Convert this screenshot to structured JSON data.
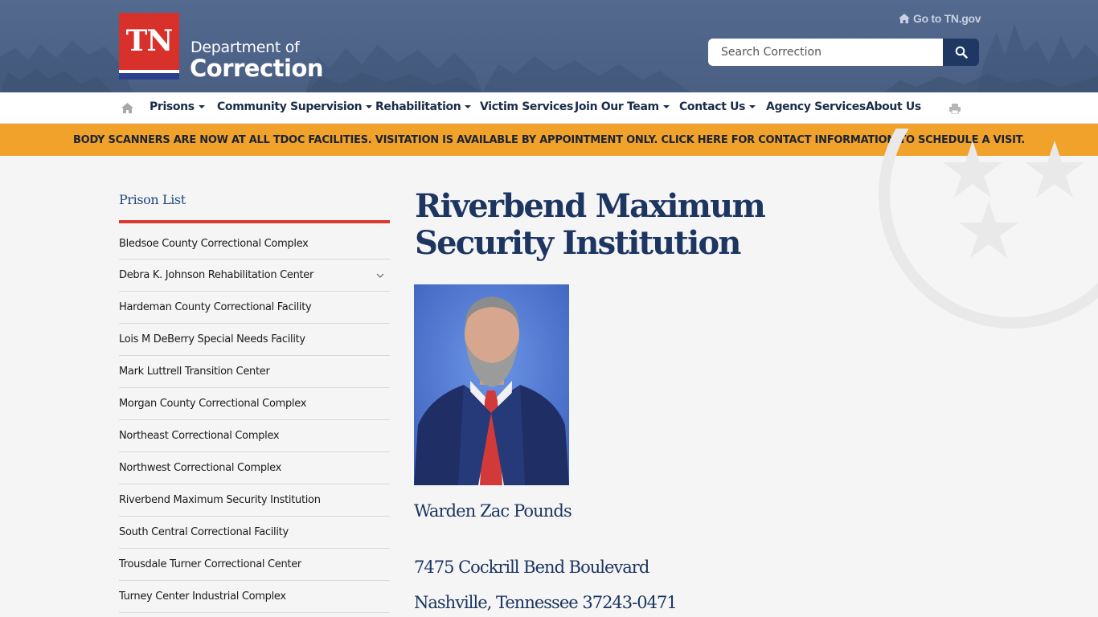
{
  "header": {
    "logo_text": "TN",
    "dept_line1": "Department of",
    "dept_line2": "Correction",
    "go_to_tn": "Go to TN.gov",
    "search_placeholder": "Search Correction"
  },
  "nav": {
    "items": [
      {
        "label": "Prisons",
        "dropdown": true
      },
      {
        "label": "Community Supervision",
        "dropdown": true
      },
      {
        "label": "Rehabilitation",
        "dropdown": true
      },
      {
        "label": "Victim Services",
        "dropdown": false
      },
      {
        "label": "Join Our Team",
        "dropdown": true
      },
      {
        "label": "Contact Us",
        "dropdown": true
      },
      {
        "label": "Agency Services",
        "dropdown": false
      },
      {
        "label": "About Us",
        "dropdown": false
      }
    ]
  },
  "alert": {
    "text": "BODY SCANNERS ARE NOW AT ALL TDOC FACILITIES. VISITATION IS AVAILABLE BY APPOINTMENT ONLY. CLICK HERE FOR CONTACT INFORMATION TO SCHEDULE A VISIT."
  },
  "sidebar": {
    "title": "Prison List",
    "items": [
      {
        "label": "Bledsoe County Correctional Complex"
      },
      {
        "label": "Debra K. Johnson Rehabilitation Center"
      },
      {
        "label": "Hardeman County Correctional Facility"
      },
      {
        "label": "Lois M DeBerry Special Needs Facility"
      },
      {
        "label": "Mark Luttrell Transition Center"
      },
      {
        "label": "Morgan County Correctional Complex"
      },
      {
        "label": "Northeast Correctional Complex"
      },
      {
        "label": "Northwest Correctional Complex"
      },
      {
        "label": "Riverbend Maximum Security Institution"
      },
      {
        "label": "South Central Correctional Facility"
      },
      {
        "label": "Trousdale Turner Correctional Center"
      },
      {
        "label": "Turney Center Industrial Complex"
      }
    ]
  },
  "main": {
    "title": "Riverbend Maximum Security Institution",
    "warden": "Warden Zac Pounds",
    "address_line1": "7475 Cockrill Bend Boulevard",
    "address_line2": "Nashville, Tennessee 37243-0471"
  },
  "colors": {
    "header_bg": "#4d6388",
    "brand_red": "#d8312c",
    "navy": "#1c3561",
    "alert_bg": "#f0a22b",
    "sidebar_rule": "#d9392f"
  }
}
